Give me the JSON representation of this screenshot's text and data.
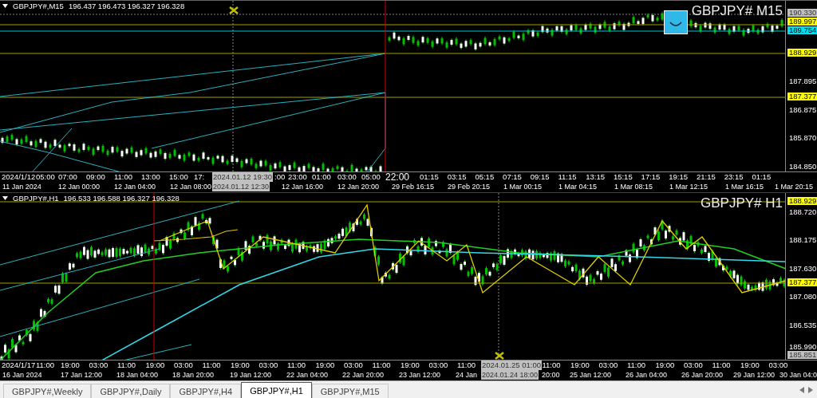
{
  "panels": [
    {
      "symbol": "GBPJPY#,M15",
      "ohlc": "196.437 196.473 196.327 196.328",
      "title": "GBPJPY# M15",
      "price_labels": [
        {
          "text": "190.330",
          "kind": "cursor"
        },
        {
          "text": "189.997",
          "kind": "level"
        },
        {
          "text": "189.754",
          "kind": "line"
        },
        {
          "text": "188.929",
          "kind": "level"
        },
        {
          "text": "187.895",
          "kind": "plain"
        },
        {
          "text": "187.377",
          "kind": "level"
        },
        {
          "text": "186.875",
          "kind": "plain"
        },
        {
          "text": "185.870",
          "kind": "plain"
        },
        {
          "text": "184.850",
          "kind": "plain"
        }
      ],
      "time_labels": [
        {
          "text": "2024/1/12",
          "kind": "plain"
        },
        {
          "text": "05:00",
          "kind": "plain"
        },
        {
          "text": "07:00",
          "kind": "plain"
        },
        {
          "text": "09:00",
          "kind": "plain"
        },
        {
          "text": "11:00",
          "kind": "plain"
        },
        {
          "text": "13:00",
          "kind": "plain"
        },
        {
          "text": "15:00",
          "kind": "plain"
        },
        {
          "text": "17:",
          "kind": "plain"
        },
        {
          "text": "2024.01.12 19:30",
          "kind": "cursor"
        },
        {
          "text": ":00",
          "kind": "plain"
        },
        {
          "text": "23:00",
          "kind": "plain"
        },
        {
          "text": "01:00",
          "kind": "plain"
        },
        {
          "text": "03:00",
          "kind": "plain"
        },
        {
          "text": "05:00",
          "kind": "plain"
        },
        {
          "text": "22:00",
          "kind": "big"
        },
        {
          "text": "01:15",
          "kind": "plain"
        },
        {
          "text": "03:15",
          "kind": "plain"
        },
        {
          "text": "05:15",
          "kind": "plain"
        },
        {
          "text": "07:15",
          "kind": "plain"
        },
        {
          "text": "09:15",
          "kind": "plain"
        },
        {
          "text": "11:15",
          "kind": "plain"
        },
        {
          "text": "13:15",
          "kind": "plain"
        },
        {
          "text": "15:15",
          "kind": "plain"
        },
        {
          "text": "17:15",
          "kind": "plain"
        },
        {
          "text": "19:15",
          "kind": "plain"
        },
        {
          "text": "21:15",
          "kind": "plain"
        },
        {
          "text": "23:15",
          "kind": "plain"
        },
        {
          "text": "01:15",
          "kind": "plain"
        }
      ],
      "date_labels": [
        {
          "text": "11 Jan 2024",
          "kind": "plain"
        },
        {
          "text": "12 Jan 00:00",
          "kind": "plain"
        },
        {
          "text": "12 Jan 04:00",
          "kind": "plain"
        },
        {
          "text": "12 Jan 08:00",
          "kind": "plain"
        },
        {
          "text": "2024.01.12 12:30",
          "kind": "cursor"
        },
        {
          "text": "12 Jan 16:00",
          "kind": "plain"
        },
        {
          "text": "12 Jan 20:00",
          "kind": "plain"
        },
        {
          "text": "29 Feb 16:15",
          "kind": "plain"
        },
        {
          "text": "29 Feb 20:15",
          "kind": "plain"
        },
        {
          "text": "1 Mar 00:15",
          "kind": "plain"
        },
        {
          "text": "1 Mar 04:15",
          "kind": "plain"
        },
        {
          "text": "1 Mar 08:15",
          "kind": "plain"
        },
        {
          "text": "1 Mar 12:15",
          "kind": "plain"
        },
        {
          "text": "1 Mar 16:15",
          "kind": "plain"
        },
        {
          "text": "1 Mar 20:15",
          "kind": "plain"
        }
      ]
    },
    {
      "symbol": "GBPJPY#,H1",
      "ohlc": "196.533 196.588 196.327 196.328",
      "title": "GBPJPY# H1",
      "price_labels": [
        {
          "text": "188.929",
          "kind": "level"
        },
        {
          "text": "188.720",
          "kind": "plain"
        },
        {
          "text": "188.175",
          "kind": "plain"
        },
        {
          "text": "187.630",
          "kind": "plain"
        },
        {
          "text": "187.377",
          "kind": "level"
        },
        {
          "text": "187.080",
          "kind": "plain"
        },
        {
          "text": "186.535",
          "kind": "plain"
        },
        {
          "text": "185.990",
          "kind": "plain"
        },
        {
          "text": "185.851",
          "kind": "cursor"
        }
      ],
      "time_labels": [
        {
          "text": "2024/1/17",
          "kind": "plain"
        },
        {
          "text": "11:00",
          "kind": "plain"
        },
        {
          "text": "19:00",
          "kind": "plain"
        },
        {
          "text": "03:00",
          "kind": "plain"
        },
        {
          "text": "11:00",
          "kind": "plain"
        },
        {
          "text": "19:00",
          "kind": "plain"
        },
        {
          "text": "03:00",
          "kind": "plain"
        },
        {
          "text": "11:00",
          "kind": "plain"
        },
        {
          "text": "19:00",
          "kind": "plain"
        },
        {
          "text": "03:00",
          "kind": "plain"
        },
        {
          "text": "11:00",
          "kind": "plain"
        },
        {
          "text": "19:00",
          "kind": "plain"
        },
        {
          "text": "03:00",
          "kind": "plain"
        },
        {
          "text": "11:00",
          "kind": "plain"
        },
        {
          "text": "19:00",
          "kind": "plain"
        },
        {
          "text": "03:00",
          "kind": "plain"
        },
        {
          "text": "11:00",
          "kind": "plain"
        },
        {
          "text": "2024.01.25 01:00",
          "kind": "cursor"
        },
        {
          "text": "11:00",
          "kind": "plain"
        },
        {
          "text": "19:00",
          "kind": "plain"
        },
        {
          "text": "03:00",
          "kind": "plain"
        },
        {
          "text": "11:00",
          "kind": "plain"
        },
        {
          "text": "19:00",
          "kind": "plain"
        },
        {
          "text": "03:00",
          "kind": "plain"
        },
        {
          "text": "11:00",
          "kind": "plain"
        },
        {
          "text": "19:00",
          "kind": "plain"
        },
        {
          "text": "03:00",
          "kind": "plain"
        }
      ],
      "date_labels": [
        {
          "text": "16 Jan 2024",
          "kind": "plain"
        },
        {
          "text": "17 Jan 12:00",
          "kind": "plain"
        },
        {
          "text": "18 Jan 04:00",
          "kind": "plain"
        },
        {
          "text": "18 Jan 20:00",
          "kind": "plain"
        },
        {
          "text": "19 Jan 12:00",
          "kind": "plain"
        },
        {
          "text": "22 Jan 04:00",
          "kind": "plain"
        },
        {
          "text": "22 Jan 20:00",
          "kind": "plain"
        },
        {
          "text": "23 Jan 12:00",
          "kind": "plain"
        },
        {
          "text": "24 Jan",
          "kind": "plain"
        },
        {
          "text": "2024.01.24 18:00",
          "kind": "cursor"
        },
        {
          "text": "20:00",
          "kind": "plain"
        },
        {
          "text": "25 Jan 12:00",
          "kind": "plain"
        },
        {
          "text": "26 Jan 04:00",
          "kind": "plain"
        },
        {
          "text": "26 Jan 20:00",
          "kind": "plain"
        },
        {
          "text": "29 Jan 12:00",
          "kind": "plain"
        },
        {
          "text": "30 Jan 04:0",
          "kind": "plain"
        }
      ]
    }
  ],
  "tabs": [
    {
      "label": "GBPJPY#,Weekly",
      "selected": false
    },
    {
      "label": "GBPJPY#,Daily",
      "selected": false
    },
    {
      "label": "GBPJPY#,H4",
      "selected": false
    },
    {
      "label": "GBPJPY#,H1",
      "selected": true
    },
    {
      "label": "GBPJPY#,M15",
      "selected": false
    }
  ]
}
